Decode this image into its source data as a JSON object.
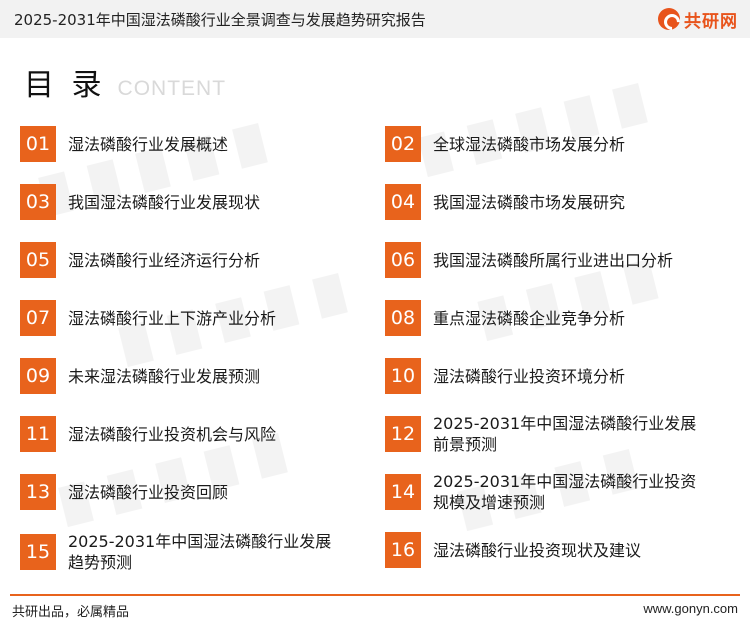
{
  "header": {
    "title": "2025-2031年中国湿法磷酸行业全景调查与发展趋势研究报告",
    "brand": "共研网"
  },
  "toc": {
    "title": "目 录",
    "subtitle": "CONTENT",
    "items": [
      {
        "num": "01",
        "label": "湿法磷酸行业发展概述"
      },
      {
        "num": "02",
        "label": "全球湿法磷酸市场发展分析"
      },
      {
        "num": "03",
        "label": "我国湿法磷酸行业发展现状"
      },
      {
        "num": "04",
        "label": "我国湿法磷酸市场发展研究"
      },
      {
        "num": "05",
        "label": "湿法磷酸行业经济运行分析"
      },
      {
        "num": "06",
        "label": "我国湿法磷酸所属行业进出口分析"
      },
      {
        "num": "07",
        "label": "湿法磷酸行业上下游产业分析"
      },
      {
        "num": "08",
        "label": "重点湿法磷酸企业竞争分析"
      },
      {
        "num": "09",
        "label": "未来湿法磷酸行业发展预测"
      },
      {
        "num": "10",
        "label": "湿法磷酸行业投资环境分析"
      },
      {
        "num": "11",
        "label": "湿法磷酸行业投资机会与风险"
      },
      {
        "num": "12",
        "label": "2025-2031年中国湿法磷酸行业发展前景预测"
      },
      {
        "num": "13",
        "label": "湿法磷酸行业投资回顾"
      },
      {
        "num": "14",
        "label": "2025-2031年中国湿法磷酸行业投资规模及增速预测"
      },
      {
        "num": "15",
        "label": "2025-2031年中国湿法磷酸行业发展趋势预测"
      },
      {
        "num": "16",
        "label": "湿法磷酸行业投资现状及建议"
      }
    ]
  },
  "footer": {
    "slogan": "共研出品，必属精品",
    "url": "www.gonyn.com"
  },
  "colors": {
    "accent": "#e8631c",
    "header_bg": "#f2f2f2"
  }
}
